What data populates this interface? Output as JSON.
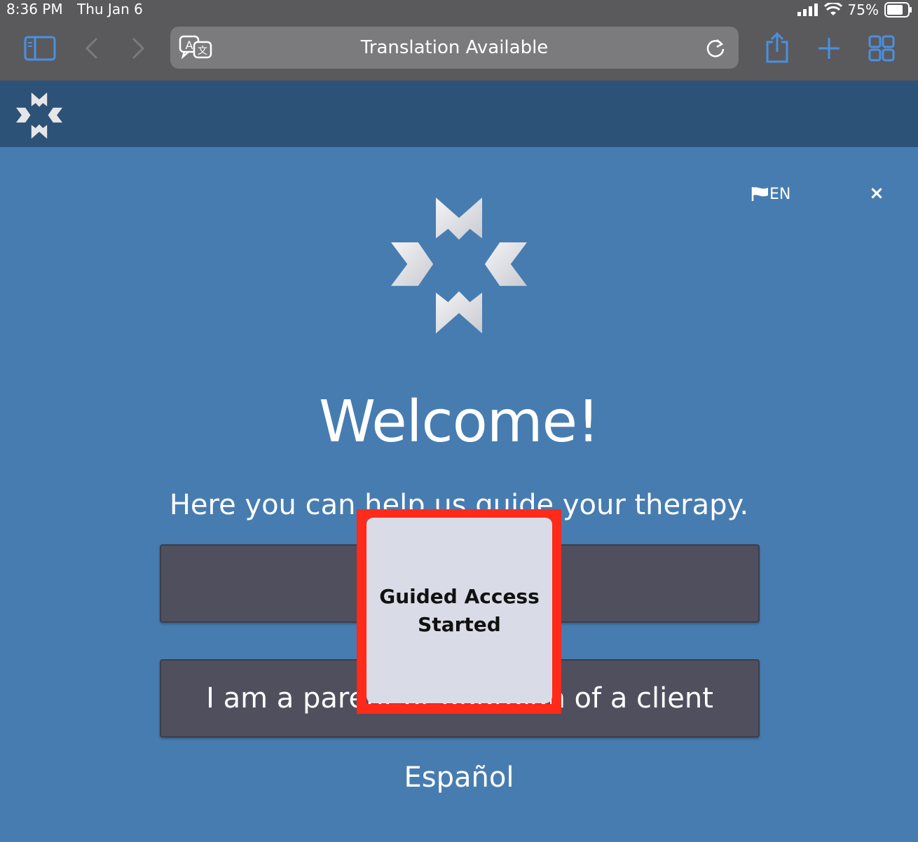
{
  "status_bar": {
    "time": "8:36 PM",
    "date": "Thu Jan 6",
    "battery": "75%"
  },
  "browser": {
    "address_text": "Translation Available",
    "icons": [
      "sidebar-icon",
      "back-icon",
      "forward-icon",
      "translate-icon",
      "reload-icon",
      "share-icon",
      "new-tab-icon",
      "tab-overview-icon"
    ],
    "accent": "#4a90e2"
  },
  "app_header": {
    "language": "EN",
    "close": "×"
  },
  "main": {
    "title": "Welcome!",
    "subtitle": "Here you can help us guide your therapy.",
    "buttons": [
      {
        "label": ""
      },
      {
        "label": "I am a parent or guardian of a client"
      }
    ],
    "language_link": "Español"
  },
  "popup": {
    "line1": "Guided Access",
    "line2": "Started"
  },
  "colors": {
    "page_bg": "#477cb1",
    "header_bg": "#2d5278",
    "button_bg": "#4f4f5e",
    "highlight": "#ff2a1a"
  }
}
